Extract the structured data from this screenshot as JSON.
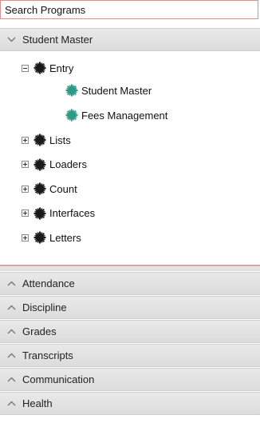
{
  "search": {
    "placeholder": "Search Programs"
  },
  "active_section": {
    "label": "Student Master",
    "icon": "chevron-down-icon"
  },
  "tree": {
    "entry": {
      "label": "Entry",
      "children": [
        "Student Master",
        "Fees Management"
      ]
    },
    "collapsed": [
      "Lists",
      "Loaders",
      "Count",
      "Interfaces",
      "Letters"
    ]
  },
  "sections": [
    "Attendance",
    "Discipline",
    "Grades",
    "Transcripts",
    "Communication",
    "Health"
  ],
  "colors": {
    "folder_gear": "#1a1a1a",
    "program_gear": "#2e9a86",
    "search_border": "#e28c8c"
  }
}
